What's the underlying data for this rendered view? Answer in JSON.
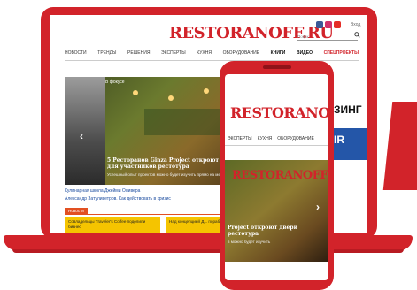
{
  "brand": {
    "logo": "RESTORANOFF.RU",
    "accent": "#d2232a"
  },
  "header": {
    "login": "Вход",
    "search_placeholder": "Поиск",
    "social": [
      {
        "icon": "facebook-icon",
        "color": "#3b5998"
      },
      {
        "icon": "instagram-icon",
        "color": "#d1306c"
      },
      {
        "icon": "youtube-icon",
        "color": "#e52d27"
      }
    ]
  },
  "nav": {
    "items": [
      "НОВОСТИ",
      "ТРЕНДЫ",
      "РЕШЕНИЯ",
      "ЭКСПЕРТЫ",
      "КУХНЯ",
      "ОБОРУДОВАНИЕ",
      "КНИГИ",
      "ВИДЕО",
      "СПЕЦПРОЕКТЫ"
    ]
  },
  "hero": {
    "tag": "В фокусе",
    "title": "5 Ресторанов Ginza Project откроют двери для участников рестотура",
    "subtitle": "Успешный опыт проектов можно будет изучить прямо на месте"
  },
  "links": [
    "Кулинарная школа Джейми Оливера",
    "Александр Затуливетров. Как действовать в кризис"
  ],
  "news": {
    "badge": "Новости",
    "cards": [
      "Совладельцы Traveler's Coffee поделили бизнес",
      "Над концепцией Д... поработает Stay Hu..."
    ]
  },
  "ads": {
    "top": "ЗИНГ",
    "mid": "IR"
  },
  "phone": {
    "nav": [
      "ЭКСПЕРТЫ",
      "КУХНЯ",
      "ОБОРУДОВАНИЕ"
    ],
    "hero_logo": "RESTORANOFF.RU",
    "title": "Project откроют двери рестотура",
    "subtitle": "в можно будет изучить"
  }
}
